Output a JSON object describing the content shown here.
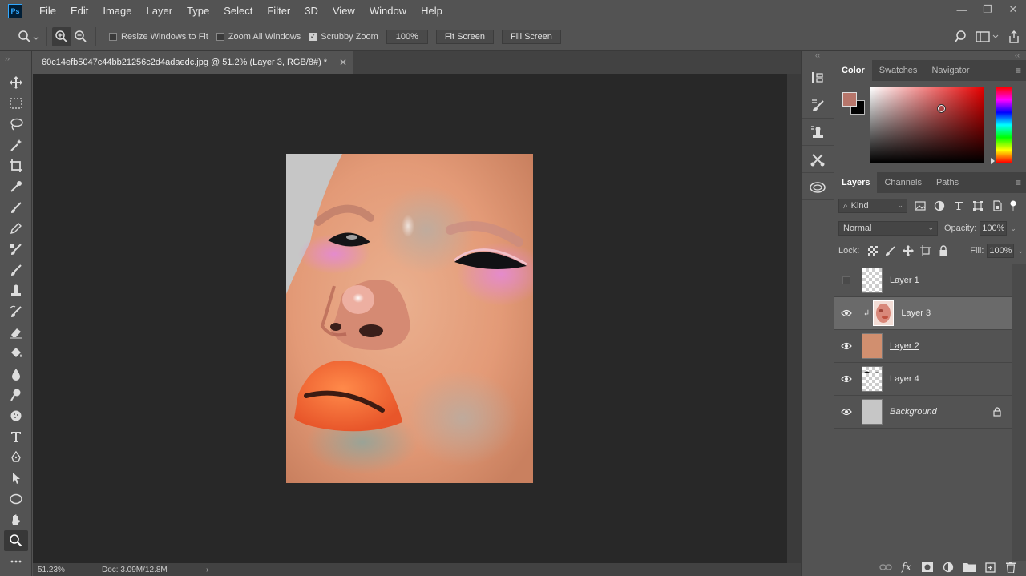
{
  "app": {
    "logo_text": "Ps",
    "menu": [
      "File",
      "Edit",
      "Image",
      "Layer",
      "Type",
      "Select",
      "Filter",
      "3D",
      "View",
      "Window",
      "Help"
    ],
    "window_controls": {
      "minimize": "—",
      "restore": "❐",
      "close": "✕"
    }
  },
  "options_bar": {
    "resize_windows_label": "Resize Windows to Fit",
    "resize_windows_checked": false,
    "zoom_all_label": "Zoom All Windows",
    "zoom_all_checked": false,
    "scrubby_zoom_label": "Scrubby Zoom",
    "scrubby_zoom_checked": true,
    "zoom_100_label": "100%",
    "fit_screen_label": "Fit Screen",
    "fill_screen_label": "Fill Screen"
  },
  "toolbar": {
    "collapse_label": "››",
    "tools": [
      "move-tool",
      "marquee-tool",
      "lasso-tool",
      "magic-wand-tool",
      "crop-tool",
      "eyedropper-tool",
      "healing-brush-tool",
      "brush-tool",
      "clone-stamp-tool",
      "history-brush-tool",
      "stamp-tool",
      "art-history-brush-tool",
      "eraser-tool",
      "paint-bucket-tool",
      "blur-tool",
      "dodge-tool",
      "sponge-tool",
      "type-tool",
      "pen-tool",
      "path-selection-tool",
      "ellipse-tool",
      "hand-tool",
      "zoom-tool",
      "more-tools"
    ],
    "selected_tool": "zoom-tool"
  },
  "document": {
    "tab_title": "60c14efb5047c44bb21256c2d4adaedc.jpg @ 51.2% (Layer 3, RGB/8#) *",
    "close_label": "✕",
    "zoom_status": "51.23%",
    "doc_status": "Doc: 3.09M/12.8M",
    "status_arrow": "›"
  },
  "panels": {
    "collapse_label": "‹‹",
    "color_tabs": [
      "Color",
      "Swatches",
      "Navigator"
    ],
    "active_color_tab": "Color",
    "foreground_color": "#b7766b",
    "background_color": "#000000",
    "layer_tabs": [
      "Layers",
      "Channels",
      "Paths"
    ],
    "active_layer_tab": "Layers",
    "kind_label": "Kind",
    "blend_mode": "Normal",
    "opacity_label": "Opacity:",
    "opacity_value": "100%",
    "lock_label": "Lock:",
    "fill_label": "Fill:",
    "fill_value": "100%",
    "layers": [
      {
        "name": "Layer 1",
        "visible": false,
        "selected": false,
        "italic": false,
        "locked": false
      },
      {
        "name": "Layer 3",
        "visible": true,
        "selected": true,
        "italic": false,
        "locked": false
      },
      {
        "name": "Layer 2",
        "visible": true,
        "selected": false,
        "italic": false,
        "locked": false
      },
      {
        "name": "Layer 4",
        "visible": true,
        "selected": false,
        "italic": false,
        "locked": false
      },
      {
        "name": "Background",
        "visible": true,
        "selected": false,
        "italic": true,
        "locked": true
      }
    ],
    "footer_fx_label": "fx"
  }
}
